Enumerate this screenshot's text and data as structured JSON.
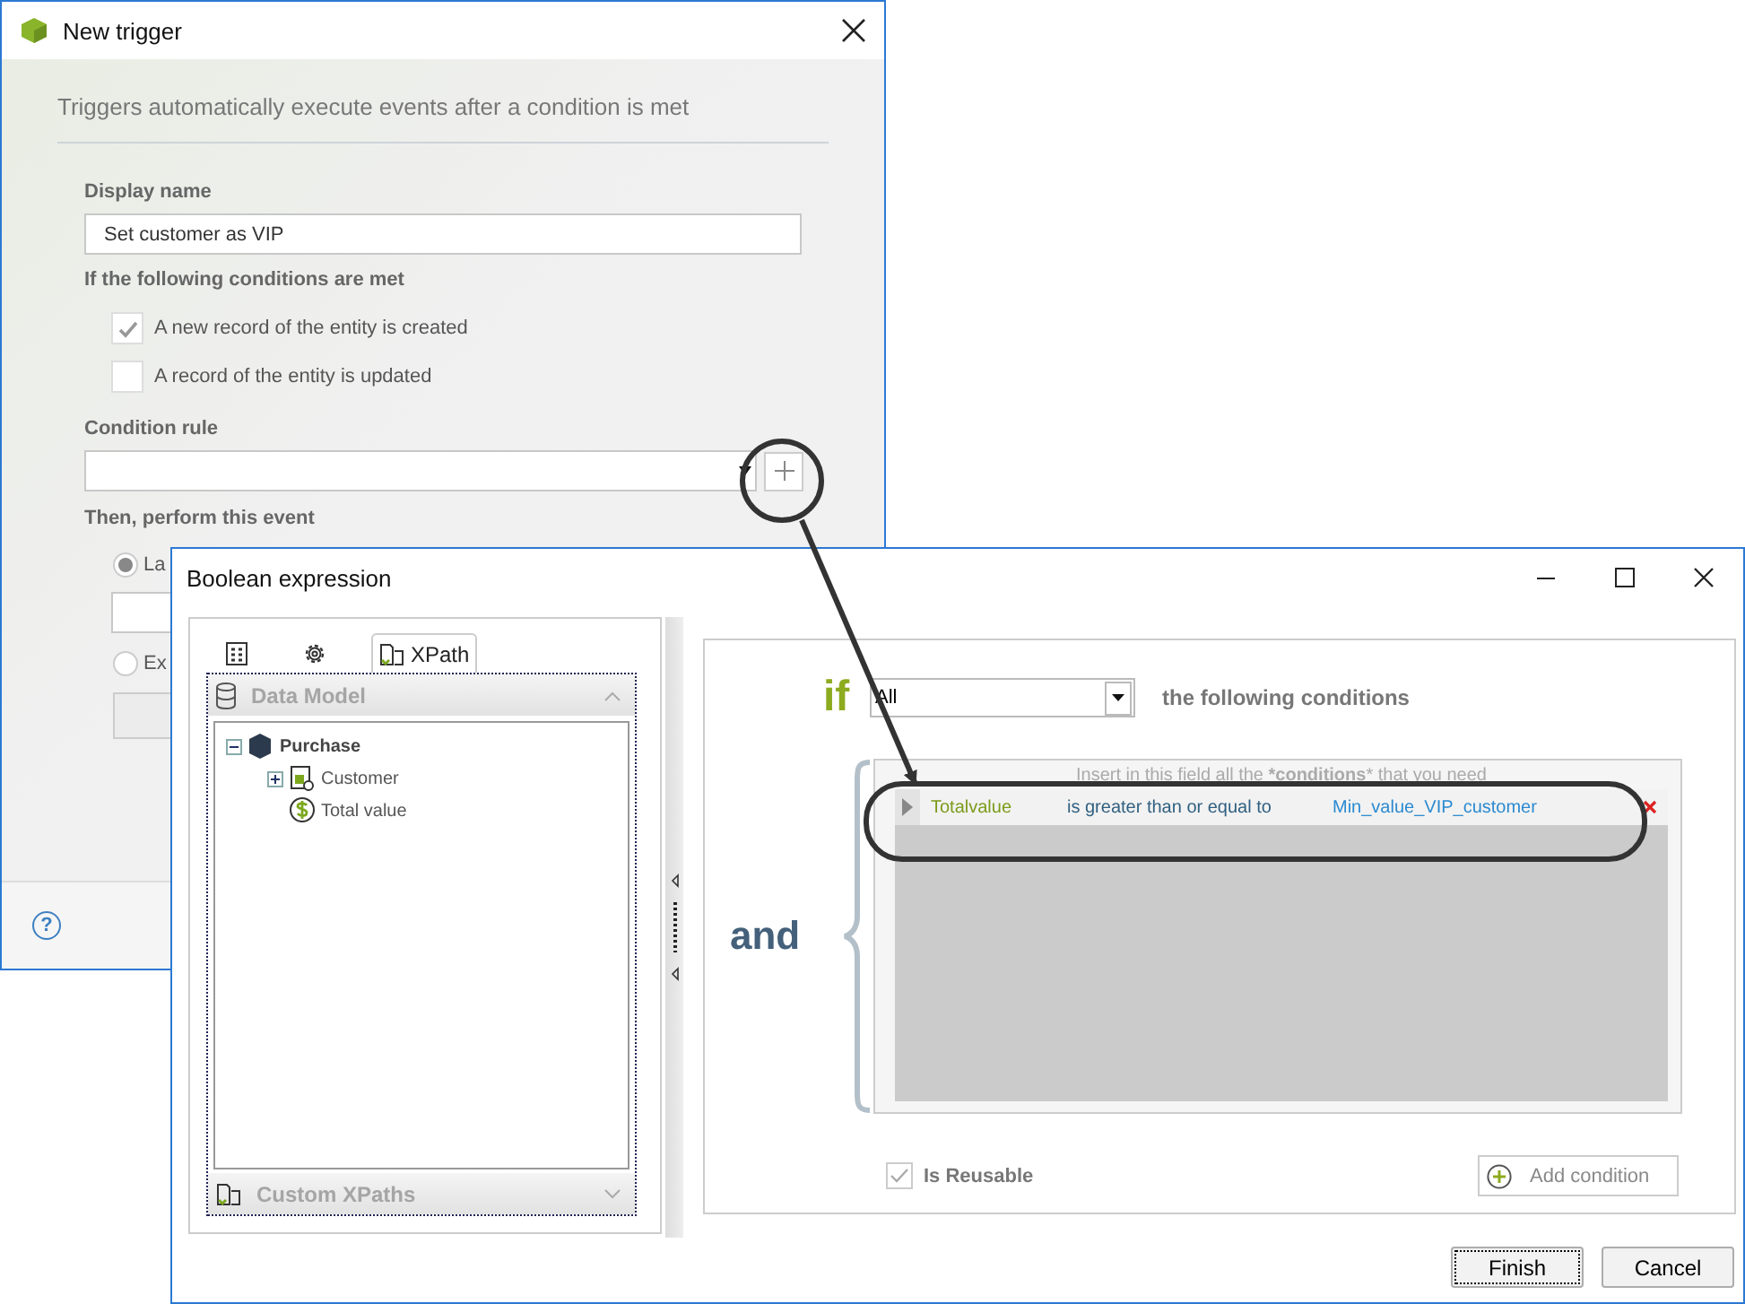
{
  "trigger_window": {
    "title": "New trigger",
    "description": "Triggers automatically execute events after a condition is met",
    "display_name": {
      "label": "Display name",
      "value": "Set customer as VIP"
    },
    "conditions_label": "If the following conditions are met",
    "events": [
      {
        "label": "A new record of the entity is created",
        "checked": true
      },
      {
        "label": "A record of the entity is updated",
        "checked": false
      }
    ],
    "condition_rule": {
      "label": "Condition rule"
    },
    "event_section": {
      "label": "Then, perform this event",
      "options": [
        {
          "label": "La",
          "selected": true
        },
        {
          "label": "Ex",
          "selected": false
        }
      ]
    },
    "help": "?"
  },
  "expression_window": {
    "title": "Boolean expression",
    "tabs": [
      {
        "kind": "grid",
        "selected": false
      },
      {
        "kind": "gear",
        "selected": false
      },
      {
        "kind": "xpath",
        "label": "XPath",
        "selected": true
      }
    ],
    "data_model": {
      "title": "Data Model",
      "tree": [
        {
          "label": "Purchase",
          "kind": "entity",
          "expanded": true,
          "children": [
            {
              "label": "Customer",
              "kind": "table",
              "expanded": false
            },
            {
              "label": "Total value",
              "kind": "currency"
            }
          ]
        }
      ]
    },
    "custom_xpaths": {
      "title": "Custom XPaths"
    },
    "if_keyword": "if",
    "quantifier": "All",
    "following_label": "the following conditions",
    "and_keyword": "and",
    "hint": "Insert in this field all the ***conditions*** that you need",
    "conditions": [
      {
        "left": "Totalvalue",
        "operator": "is greater than or equal to",
        "right": "Min_value_VIP_customer"
      }
    ],
    "is_reusable": {
      "label": "Is Reusable",
      "checked": true
    },
    "add_condition": "Add condition",
    "buttons": [
      {
        "label": "Finish",
        "focused": true
      },
      {
        "label": "Cancel",
        "focused": false
      }
    ]
  }
}
